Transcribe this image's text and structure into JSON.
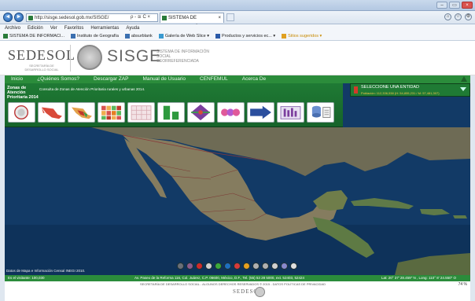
{
  "browser": {
    "url": "http://sisge.sedesol.gob.mx/SISGE/",
    "url_tools": "ρ - ≅ C ×",
    "tab_title": "SISTEMA DE INFORMACIÓ...",
    "tab_close": "×",
    "win_buttons": [
      "–",
      "▭",
      "×"
    ],
    "nav_back": "◄",
    "nav_forward": "►",
    "tool_icons": [
      "⌂",
      "☆",
      "⚙"
    ],
    "menu": [
      "Archivo",
      "Edición",
      "Ver",
      "Favoritos",
      "Herramientas",
      "Ayuda"
    ],
    "favorites": [
      {
        "label": "SISTEMA DE INFORMACI...",
        "color": "#2a7b3a"
      },
      {
        "label": "Instituto de Geografía",
        "color": "#3a6fb0"
      },
      {
        "label": "absurblank",
        "color": "#3a6fb0"
      },
      {
        "label": "Galería de Web Slice ▾",
        "color": "#3a9ad0"
      },
      {
        "label": "Productos y servicios ec... ▾",
        "color": "#2b5aa8"
      },
      {
        "label": "Sitios sugeridos ▾",
        "color": "#e0a020"
      }
    ],
    "zoom": "74 %"
  },
  "header": {
    "sedesol": "SEDESOL",
    "sedesol_sub": "SECRETARÍA DE DESARROLLO SOCIAL",
    "sisge": "SISGE",
    "sisge_sub": "SISTEMA DE INFORMACIÓN SOCIAL GEORREFERENCIADA"
  },
  "nav": {
    "items": [
      "Inicio",
      "¿Quiénes Somos?",
      "Descargar ZAP",
      "Manual de Usuario",
      "CENFEMUL",
      "Acerca De"
    ]
  },
  "toolbar": {
    "title": "Zonas de Atención Prioritaria 2014",
    "description": "Consulta de Zonas de Atención Prioritaria rurales y urbanas 2014.",
    "tools": [
      {
        "name": "tool-seal"
      },
      {
        "name": "tool-map-mexico-red"
      },
      {
        "name": "tool-map-mexico-color"
      },
      {
        "name": "tool-grid-colors"
      },
      {
        "name": "tool-grid-light"
      },
      {
        "name": "tool-bars-green"
      },
      {
        "name": "tool-diamond"
      },
      {
        "name": "tool-hexagons"
      },
      {
        "name": "tool-sedesol-arrow"
      },
      {
        "name": "tool-table"
      },
      {
        "name": "tool-sql-capa"
      }
    ]
  },
  "entity": {
    "title": "SELECCIONE UNA ENTIDAD",
    "stats": "Población: 112,336,538  (H: 54,855,231 / M: 57,481,307)"
  },
  "map": {
    "credit": "Datos de Mapa e Información Censal INEGI 2010.",
    "control_colors": [
      "#6a6f78",
      "#8c5a8c",
      "#cf2a2a",
      "#d0d0d0",
      "#3caa3c",
      "#1e6fc0",
      "#d83a3a",
      "#e6a020",
      "#b0b0b0",
      "#b0b0b0",
      "#d0d0d0",
      "#8888cc",
      "#e0e0e0"
    ]
  },
  "status": {
    "visits": "Es el visitante: 100,030",
    "address": "Av. Paseo de la Reforma 116, Col. Juárez, C.P. 06600, México, D.F., Tel. (55) 53 28 5000, ext. 52403, 52424",
    "coords": "Lat: 20° 37' 28.459\" N , Long: 110° 8' 24.550\" O"
  },
  "footer": {
    "line": "SECRETARÍA DE DESARROLLO SOCIAL - ALGUNOS DERECHOS RESERVADOS © 2015 - DATOS POLÍTICAS DE PRIVACIDAD",
    "logo": "SEDESOL"
  }
}
